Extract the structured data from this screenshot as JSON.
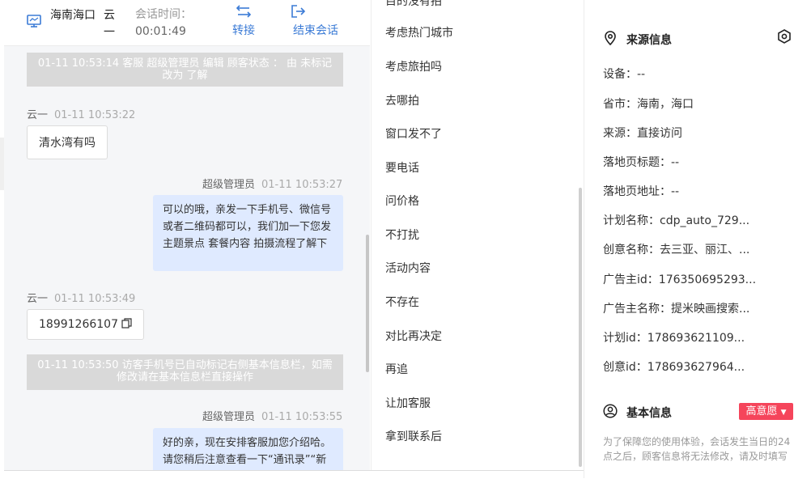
{
  "header": {
    "region": "海南海口",
    "user": "云一",
    "time_label": "会话时间：",
    "time_value": "00:01:49",
    "transfer_label": "转接",
    "end_label": "结束会话"
  },
  "chat": {
    "sys1": "01-11 10:53:14 客服 超级管理员 编辑 顾客状态 ： 由 未标记 改为 了解",
    "msg1_sender": "云一",
    "msg1_time": "01-11 10:53:22",
    "msg1_text": "清水湾有吗",
    "msg2_sender": "超级管理员",
    "msg2_time": "01-11 10:53:27",
    "msg2_text": "可以的哦，亲发一下手机号、微信号或者二维码都可以，我们加一下您发主题景点 套餐内容 拍摄流程了解下",
    "msg3_sender": "云一",
    "msg3_time": "01-11 10:53:49",
    "msg3_text": "18991266107",
    "sys2": "01-11 10:53:50 访客手机号已自动标记右侧基本信息栏，如需修改请在基本信息栏直接操作",
    "msg4_sender": "超级管理员",
    "msg4_time": "01-11 10:53:55",
    "msg4_text": "好的亲，现在安排客服加您介绍哈。请您稍后注意查看一下“通讯录”“新的朋友”“通过下班"
  },
  "phrases": {
    "cut_top": "目的没有拍",
    "items": [
      "考虑热门城市",
      "考虑旅拍吗",
      "去哪拍",
      "窗口发不了",
      "要电话",
      "问价格",
      "不打扰",
      "活动内容",
      "不存在",
      "对比再决定",
      "再追",
      "让加客服",
      "拿到联系后"
    ]
  },
  "info": {
    "source_title": "来源信息",
    "device_k": "设备：",
    "device_v": "--",
    "province_k": "省市：",
    "province_v": "海南，海口",
    "source_k": "来源：",
    "source_v": "直接访问",
    "landing_title_k": "落地页标题：",
    "landing_title_v": "--",
    "landing_url_k": "落地页地址：",
    "landing_url_v": "--",
    "plan_name_k": "计划名称：",
    "plan_name_v": "cdp_auto_729...",
    "creative_name_k": "创意名称：",
    "creative_name_v": "去三亚、丽江、...",
    "adv_id_k": "广告主id：",
    "adv_id_v": "176350695293...",
    "adv_name_k": "广告主名称：",
    "adv_name_v": "提米映画搜索...",
    "plan_id_k": "计划id：",
    "plan_id_v": "178693621109...",
    "creative_id_k": "创意id：",
    "creative_id_v": "178693627964...",
    "basic_title": "基本信息",
    "intent_badge": "高意愿",
    "note": "为了保障您的使用体验，会话发生当日的24点之后，顾客信息将无法修改，请及时填写"
  },
  "colors": {
    "accent": "#3b7bd6",
    "badge": "#f5455b",
    "bubble_right": "#dfeaff",
    "system": "#d9d9d9"
  }
}
